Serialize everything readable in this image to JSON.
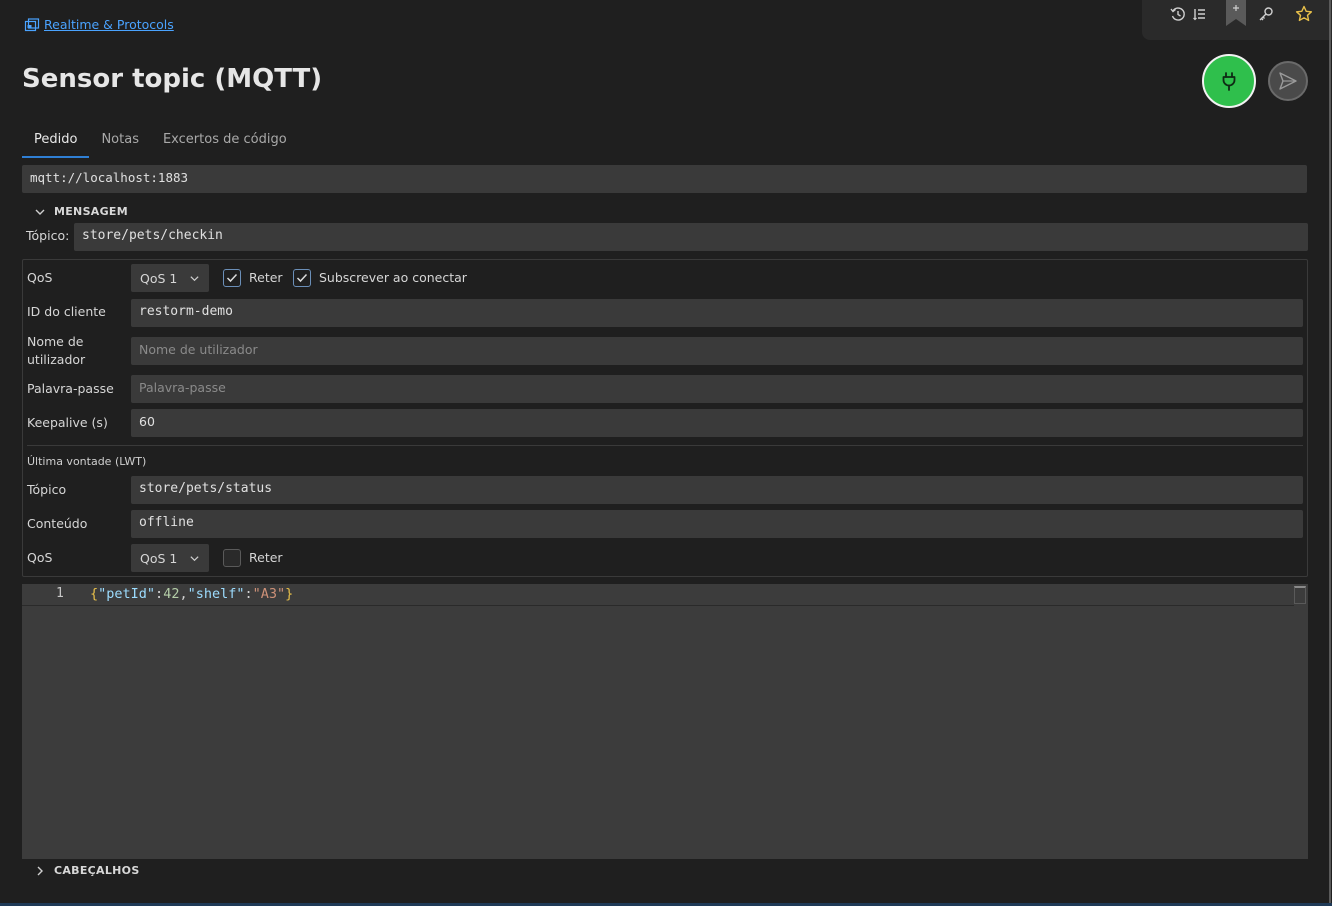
{
  "breadcrumb": {
    "label": "Realtime & Protocols"
  },
  "title": "Sensor topic (MQTT)",
  "tabs": [
    {
      "label": "Pedido",
      "active": true
    },
    {
      "label": "Notas",
      "active": false
    },
    {
      "label": "Excertos de código",
      "active": false
    }
  ],
  "url": "mqtt://localhost:1883",
  "message_section": {
    "label": "MENSAGEM",
    "expanded": true
  },
  "topic": {
    "label": "Tópico:",
    "value": "store/pets/checkin"
  },
  "options": {
    "qos": {
      "label": "QoS",
      "value": "QoS 1"
    },
    "retain": {
      "label": "Reter",
      "checked": true
    },
    "subscribe": {
      "label": "Subscrever ao conectar",
      "checked": true
    },
    "client_id": {
      "label": "ID do cliente",
      "value": "restorm-demo"
    },
    "username": {
      "label_line1": "Nome de",
      "label_line2": "utilizador",
      "placeholder": "Nome de utilizador"
    },
    "password": {
      "label": "Palavra-passe",
      "placeholder": "Palavra-passe"
    },
    "keepalive": {
      "label": "Keepalive (s)",
      "value": "60"
    }
  },
  "lwt": {
    "title": "Última vontade (LWT)",
    "topic": {
      "label": "Tópico",
      "value": "store/pets/status"
    },
    "content": {
      "label": "Conteúdo",
      "value": "offline"
    },
    "qos": {
      "label": "QoS",
      "value": "QoS 1"
    },
    "retain": {
      "label": "Reter",
      "checked": false
    }
  },
  "editor": {
    "line_number": "1",
    "tokens": {
      "open": "{",
      "key1": "\"petId\"",
      "colon1": ":",
      "val1": "42",
      "comma": ",",
      "key2": "\"shelf\"",
      "colon2": ":",
      "val2": "\"A3\"",
      "close": "}"
    }
  },
  "headers_section": {
    "label": "CABEÇALHOS",
    "expanded": false
  },
  "icons": {
    "breadcrumb": "collection-icon",
    "toolbar": [
      "history-icon",
      "list-icon",
      "bookmark-icon",
      "key-icon",
      "star-icon"
    ],
    "connect": "plug-icon",
    "send": "send-icon"
  },
  "colors": {
    "accent": "#2f7fd4",
    "connect": "#2fbf4c",
    "link": "#4aa3ff",
    "star": "#e8c04a"
  }
}
